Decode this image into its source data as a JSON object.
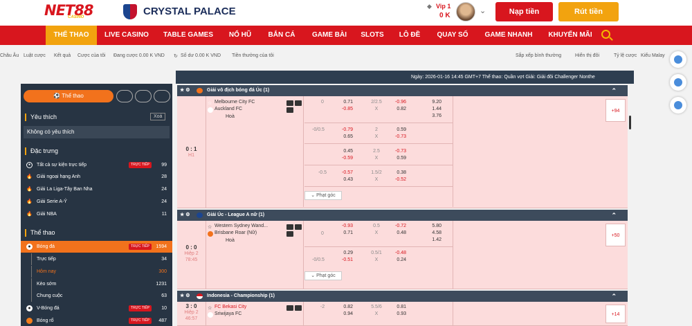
{
  "header": {
    "logo": "NET88",
    "logo_sub": "CASINO",
    "partner": "CRYSTAL PALACE",
    "vip": "Vip 1",
    "balance": "0 K",
    "deposit": "Nạp tiền",
    "withdraw": "Rút tiền"
  },
  "nav": [
    {
      "label": "THỂ THAO",
      "active": true
    },
    {
      "label": "LIVE CASINO"
    },
    {
      "label": "TABLE GAMES"
    },
    {
      "label": "NỔ HŨ"
    },
    {
      "label": "BẮN CÁ"
    },
    {
      "label": "GAME BÀI"
    },
    {
      "label": "SLOTS"
    },
    {
      "label": "LÔ ĐỀ"
    },
    {
      "label": "QUAY SỐ"
    },
    {
      "label": "GAME NHANH"
    },
    {
      "label": "KHUYẾN MÃI"
    }
  ],
  "toolbar": {
    "items": [
      "Châu Âu",
      "Luật cược",
      "Kết quả",
      "Cược của tôi",
      "Đang cược 0.00 K VND",
      "Số dư 0.00 K VND",
      "Tiền thưởng của tôi"
    ],
    "sort": "Sắp xếp bình thường",
    "display": "Hiển thị đôi",
    "odds": "Tỷ lệ cược",
    "odds_val": "Kiểu Malay"
  },
  "announcement": "Ngày: 2026-01-16 14:45 GMT+7 Thể thao: Quần vợt Giải: Giải đôi Challenger Nonthe",
  "sidebar": {
    "tab": "Thể thao",
    "favorites": "Yêu thích",
    "clear": "Xoá",
    "empty": "Không có yêu thích",
    "featured": "Đặc trưng",
    "sports": "Thể thao",
    "live": "TRỰC TIẾP",
    "featured_items": [
      {
        "label": "Tất cả sự kiện trực tiếp",
        "count": "99",
        "live": true
      },
      {
        "label": "Giải ngoại hạng Anh",
        "count": "28"
      },
      {
        "label": "Giải La Liga-Tây Ban Nha",
        "count": "24"
      },
      {
        "label": "Giải Serie A-Ý",
        "count": "24"
      },
      {
        "label": "Giải NBA",
        "count": "11"
      }
    ],
    "sport_items": [
      {
        "label": "Bóng đá",
        "count": "1594",
        "live": true
      },
      {
        "label": "Trực tiếp",
        "count": "34"
      },
      {
        "label": "Hôm nay",
        "count": "300"
      },
      {
        "label": "Kèo sớm",
        "count": "1231"
      },
      {
        "label": "Chung cuộc",
        "count": "63"
      },
      {
        "label": "V-Bóng đá",
        "count": "10",
        "live": true
      },
      {
        "label": "Bóng rổ",
        "count": "487",
        "live": true
      }
    ]
  },
  "leagues": [
    {
      "name": "Giải vô địch bóng đá Úc (1)",
      "score": "0 : 1",
      "time": "H1",
      "home": "Melbourne City FC",
      "away": "Auckland FC",
      "draw": "Hoà",
      "more": "+94",
      "corner": "Phạt góc",
      "lines": [
        [
          "0",
          "0.71",
          "-0.85",
          "2/2.5",
          "X",
          "-0.96",
          "0.82",
          "9.20",
          "1.44",
          "3.76"
        ],
        [
          "-0/0.5",
          "-0.79",
          "0.65",
          "2",
          "X",
          "0.59",
          "-0.73"
        ],
        [
          "",
          "0.45",
          "-0.59",
          "2.5",
          "X",
          "-0.73",
          "0.59"
        ],
        [
          "-0.5",
          "-0.57",
          "0.43",
          "1.5/2",
          "X",
          "0.38",
          "-0.52"
        ]
      ]
    },
    {
      "name": "Giải Úc - League A nữ (1)",
      "score": "0 : 0",
      "time": "Hiệp 2",
      "time2": "78:45",
      "home": "Western Sydney Wand...",
      "away": "Brisbane Roar (Nữ)",
      "draw": "Hoà",
      "more": "+50",
      "corner": "Phạt góc",
      "lines": [
        [
          "0",
          "-0.93",
          "0.71",
          "0.5",
          "X",
          "-0.72",
          "0.48",
          "5.80",
          "4.58",
          "1.42"
        ],
        [
          "-0/0.5",
          "0.29",
          "-0.51",
          "0.5/1",
          "X",
          "-0.48",
          "0.24"
        ]
      ]
    },
    {
      "name": "Indonesia - Championship (1)",
      "score": "3 : 0",
      "time": "Hiệp 2",
      "time2": "46:57",
      "home": "FC Bekasi City",
      "away": "Sriwijaya FC",
      "more": "+14",
      "lines": [
        [
          "-2",
          "0.82",
          "0.94",
          "5.5/6",
          "X",
          "0.81",
          "0.93"
        ]
      ]
    }
  ]
}
